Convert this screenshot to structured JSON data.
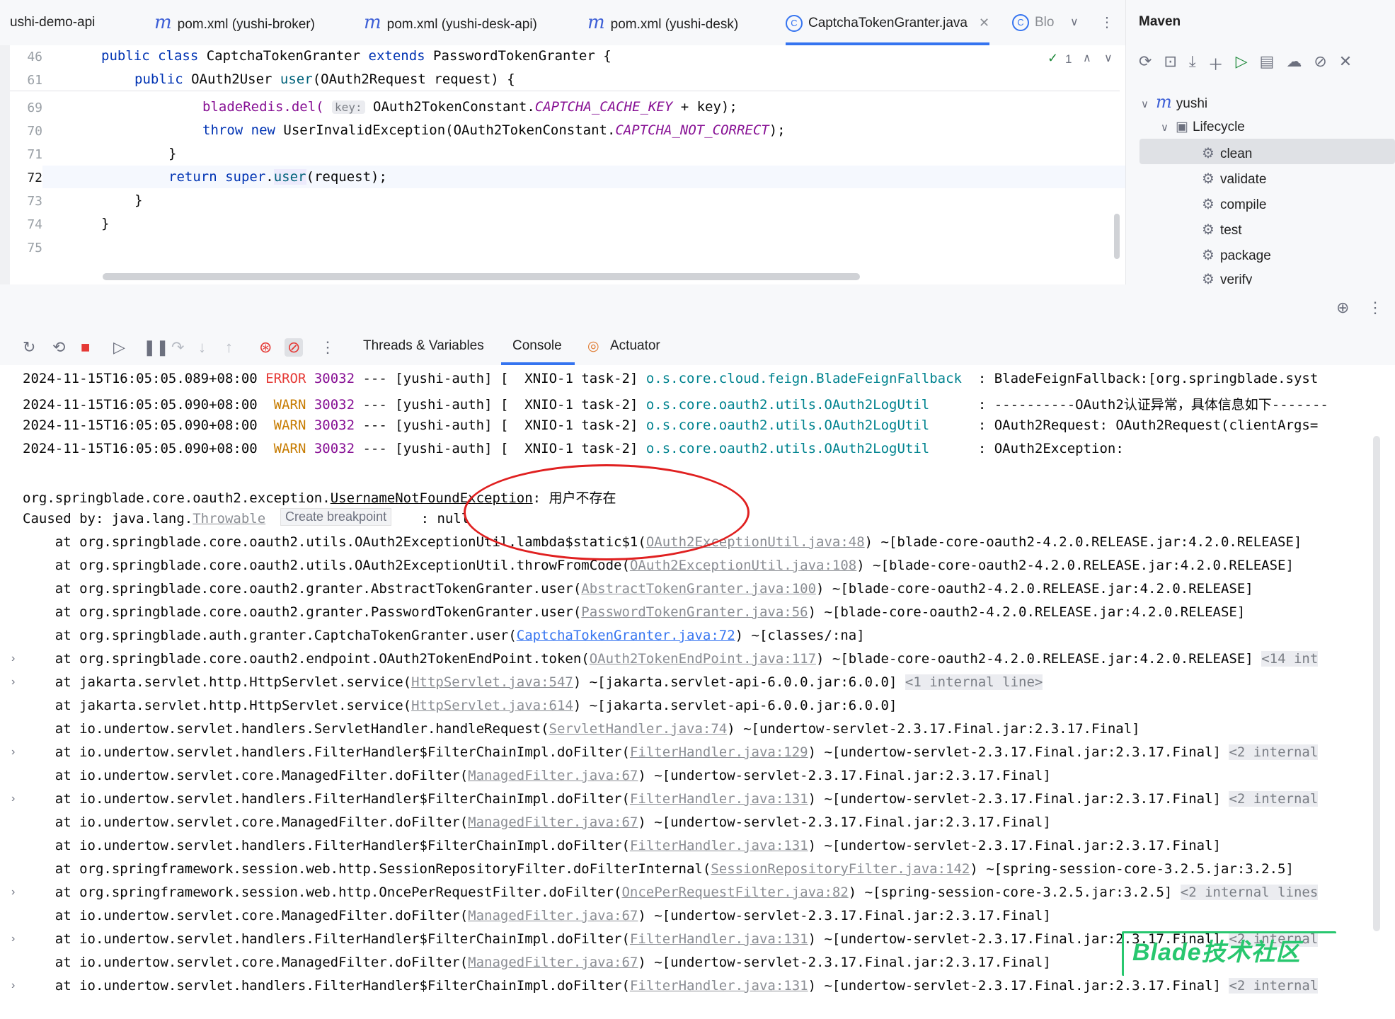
{
  "tabs": [
    {
      "label": "ushi-demo-api",
      "icon": "module-icon"
    },
    {
      "label": "pom.xml (yushi-broker)",
      "icon": "maven-icon"
    },
    {
      "label": "pom.xml (yushi-desk-api)",
      "icon": "maven-icon"
    },
    {
      "label": "pom.xml (yushi-desk)",
      "icon": "maven-icon"
    },
    {
      "label": "CaptchaTokenGranter.java",
      "icon": "class-icon",
      "active": true
    },
    {
      "label": "Blo",
      "icon": "class-icon"
    }
  ],
  "editor": {
    "inspection_count": "1",
    "lines": [
      {
        "num": "46"
      },
      {
        "num": "61"
      },
      {
        "num": "69"
      },
      {
        "num": "70"
      },
      {
        "num": "71"
      },
      {
        "num": "72"
      },
      {
        "num": "73"
      },
      {
        "num": "74"
      },
      {
        "num": "75"
      }
    ],
    "code": {
      "l46_a": "public class",
      "l46_b": " CaptchaTokenGranter ",
      "l46_c": "extends",
      "l46_d": " PasswordTokenGranter {",
      "l61_a": "public",
      "l61_b": " OAuth2User ",
      "l61_c": "user",
      "l61_d": "(OAuth2Request request) {",
      "l69_a": "bladeRedis.del(",
      "l69_hint": "key:",
      "l69_b": " OAuth2TokenConstant.",
      "l69_c": "CAPTCHA_CACHE_KEY",
      "l69_d": " + key);",
      "l70_a": "throw new",
      "l70_b": " UserInvalidException(OAuth2TokenConstant.",
      "l70_c": "CAPTCHA_NOT_CORRECT",
      "l70_d": ");",
      "l71": "}",
      "l72_a": "return super",
      "l72_b": ".",
      "l72_c": "user",
      "l72_d": "(request);",
      "l73": "}",
      "l74": "}"
    }
  },
  "maven": {
    "title": "Maven",
    "root": "yushi",
    "lifecycle": "Lifecycle",
    "goals": [
      "clean",
      "validate",
      "compile",
      "test",
      "package",
      "verify"
    ]
  },
  "debug": {
    "tabs": [
      "Threads & Variables",
      "Console",
      "Actuator"
    ]
  },
  "console": {
    "log": [
      {
        "ts": "2024-11-15T16:05:05.089+08:00",
        "level": "ERROR",
        "pid": "30032",
        "mid": " --- [yushi-auth] [  XNIO-1 task-2] ",
        "logger": "o.s.core.cloud.feign.BladeFeignFallback",
        "msg": "  : BladeFeignFallback:[org.springblade.syst"
      },
      {
        "ts": "2024-11-15T16:05:05.090+08:00",
        "level": " WARN",
        "pid": "30032",
        "mid": " --- [yushi-auth] [  XNIO-1 task-2] ",
        "logger": "o.s.core.oauth2.utils.OAuth2LogUtil    ",
        "msg": "  : ----------OAuth2认证异常，具体信息如下-------"
      },
      {
        "ts": "2024-11-15T16:05:05.090+08:00",
        "level": " WARN",
        "pid": "30032",
        "mid": " --- [yushi-auth] [  XNIO-1 task-2] ",
        "logger": "o.s.core.oauth2.utils.OAuth2LogUtil    ",
        "msg": "  : OAuth2Request: OAuth2Request(clientArgs="
      },
      {
        "ts": "2024-11-15T16:05:05.090+08:00",
        "level": " WARN",
        "pid": "30032",
        "mid": " --- [yushi-auth] [  XNIO-1 task-2] ",
        "logger": "o.s.core.oauth2.utils.OAuth2LogUtil    ",
        "msg": "  : OAuth2Exception:"
      }
    ],
    "exception_pre": "org.springblade.core.oauth2.exception.",
    "exception_name": "UsernameNotFoundException",
    "exception_msg": ": 用户不存在",
    "caused_pre": "Caused by: java.lang.",
    "caused_link": "Throwable",
    "caused_post": " : null",
    "tooltip": "Create breakpoint",
    "watermark": "Blade技术社区",
    "frames": [
      {
        "pre": "    at org.springblade.core.oauth2.utils.OAuth2ExceptionUtil.lambda$static$1(",
        "link": "OAuth2ExceptionUtil.java:48",
        "post": ") ~[blade-core-oauth2-4.2.0.RELEASE.jar:4.2.0.RELEASE]",
        "int": ""
      },
      {
        "pre": "    at org.springblade.core.oauth2.utils.OAuth2ExceptionUtil.throwFromCode(",
        "link": "OAuth2ExceptionUtil.java:108",
        "post": ") ~[blade-core-oauth2-4.2.0.RELEASE.jar:4.2.0.RELEASE]",
        "int": ""
      },
      {
        "pre": "    at org.springblade.core.oauth2.granter.AbstractTokenGranter.user(",
        "link": "AbstractTokenGranter.java:100",
        "post": ") ~[blade-core-oauth2-4.2.0.RELEASE.jar:4.2.0.RELEASE]",
        "int": ""
      },
      {
        "pre": "    at org.springblade.core.oauth2.granter.PasswordTokenGranter.user(",
        "link": "PasswordTokenGranter.java:56",
        "post": ") ~[blade-core-oauth2-4.2.0.RELEASE.jar:4.2.0.RELEASE]",
        "int": ""
      },
      {
        "pre": "    at org.springblade.auth.granter.CaptchaTokenGranter.user(",
        "link": "CaptchaTokenGranter.java:72",
        "post": ") ~[classes/:na]",
        "int": "",
        "blue": true
      },
      {
        "pre": "    at org.springblade.core.oauth2.endpoint.OAuth2TokenEndPoint.token(",
        "link": "OAuth2TokenEndPoint.java:117",
        "post": ") ~[blade-core-oauth2-4.2.0.RELEASE.jar:4.2.0.RELEASE]",
        "int": "<14 int",
        "fold": true
      },
      {
        "pre": "    at jakarta.servlet.http.HttpServlet.service(",
        "link": "HttpServlet.java:547",
        "post": ") ~[jakarta.servlet-api-6.0.0.jar:6.0.0]",
        "int": "<1 internal line>",
        "fold": true
      },
      {
        "pre": "    at jakarta.servlet.http.HttpServlet.service(",
        "link": "HttpServlet.java:614",
        "post": ") ~[jakarta.servlet-api-6.0.0.jar:6.0.0]",
        "int": ""
      },
      {
        "pre": "    at io.undertow.servlet.handlers.ServletHandler.handleRequest(",
        "link": "ServletHandler.java:74",
        "post": ") ~[undertow-servlet-2.3.17.Final.jar:2.3.17.Final]",
        "int": ""
      },
      {
        "pre": "    at io.undertow.servlet.handlers.FilterHandler$FilterChainImpl.doFilter(",
        "link": "FilterHandler.java:129",
        "post": ") ~[undertow-servlet-2.3.17.Final.jar:2.3.17.Final]",
        "int": "<2 internal",
        "fold": true
      },
      {
        "pre": "    at io.undertow.servlet.core.ManagedFilter.doFilter(",
        "link": "ManagedFilter.java:67",
        "post": ") ~[undertow-servlet-2.3.17.Final.jar:2.3.17.Final]",
        "int": ""
      },
      {
        "pre": "    at io.undertow.servlet.handlers.FilterHandler$FilterChainImpl.doFilter(",
        "link": "FilterHandler.java:131",
        "post": ") ~[undertow-servlet-2.3.17.Final.jar:2.3.17.Final]",
        "int": "<2 internal",
        "fold": true
      },
      {
        "pre": "    at io.undertow.servlet.core.ManagedFilter.doFilter(",
        "link": "ManagedFilter.java:67",
        "post": ") ~[undertow-servlet-2.3.17.Final.jar:2.3.17.Final]",
        "int": ""
      },
      {
        "pre": "    at io.undertow.servlet.handlers.FilterHandler$FilterChainImpl.doFilter(",
        "link": "FilterHandler.java:131",
        "post": ") ~[undertow-servlet-2.3.17.Final.jar:2.3.17.Final]",
        "int": ""
      },
      {
        "pre": "    at org.springframework.session.web.http.SessionRepositoryFilter.doFilterInternal(",
        "link": "SessionRepositoryFilter.java:142",
        "post": ") ~[spring-session-core-3.2.5.jar:3.2.5]",
        "int": ""
      },
      {
        "pre": "    at org.springframework.session.web.http.OncePerRequestFilter.doFilter(",
        "link": "OncePerRequestFilter.java:82",
        "post": ") ~[spring-session-core-3.2.5.jar:3.2.5]",
        "int": "<2 internal lines",
        "fold": true
      },
      {
        "pre": "    at io.undertow.servlet.core.ManagedFilter.doFilter(",
        "link": "ManagedFilter.java:67",
        "post": ") ~[undertow-servlet-2.3.17.Final.jar:2.3.17.Final]",
        "int": ""
      },
      {
        "pre": "    at io.undertow.servlet.handlers.FilterHandler$FilterChainImpl.doFilter(",
        "link": "FilterHandler.java:131",
        "post": ") ~[undertow-servlet-2.3.17.Final.jar:2.3.17.Final]",
        "int": "<2 internal",
        "fold": true
      },
      {
        "pre": "    at io.undertow.servlet.core.ManagedFilter.doFilter(",
        "link": "ManagedFilter.java:67",
        "post": ") ~[undertow-servlet-2.3.17.Final.jar:2.3.17.Final]",
        "int": ""
      },
      {
        "pre": "    at io.undertow.servlet.handlers.FilterHandler$FilterChainImpl.doFilter(",
        "link": "FilterHandler.java:131",
        "post": ") ~[undertow-servlet-2.3.17.Final.jar:2.3.17.Final]",
        "int": "<2 internal",
        "fold": true
      }
    ]
  }
}
